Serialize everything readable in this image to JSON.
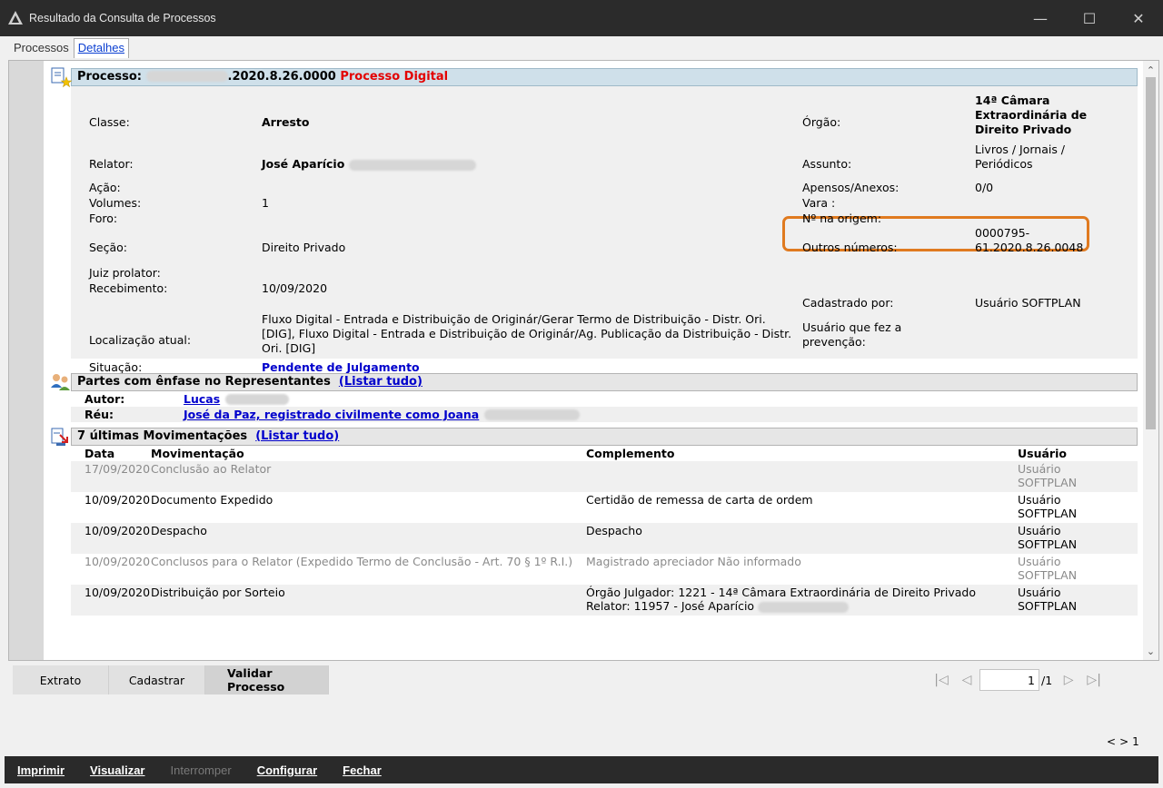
{
  "window": {
    "title": "Resultado da Consulta de Processos"
  },
  "tabs": [
    {
      "label": "Processos"
    },
    {
      "label": "Detalhes"
    }
  ],
  "processo": {
    "header_prefix": "Processo:",
    "numero_visible": ".2020.8.26.0000",
    "tag": "Processo Digital",
    "fields": {
      "classe_label": "Classe:",
      "classe": "Arresto",
      "relator_label": "Relator:",
      "relator": "José Aparício",
      "acao_label": "Ação:",
      "volumes_label": "Volumes:",
      "volumes": "1",
      "foro_label": "Foro:",
      "secao_label": "Seção:",
      "secao": "Direito Privado",
      "juiz_label": "Juiz prolator:",
      "recebimento_label": "Recebimento:",
      "recebimento": "10/09/2020",
      "localizacao_label": "Localização atual:",
      "localizacao": "Fluxo Digital - Entrada e Distribuição de Originár/Gerar Termo de Distribuição - Distr. Ori. [DIG], Fluxo Digital - Entrada e Distribuição de Originár/Ag. Publicação da Distribuição - Distr. Ori. [DIG]",
      "situacao_label": "Situação:",
      "situacao": "Pendente de Julgamento",
      "orgao_label": "Órgão:",
      "orgao": "14ª Câmara Extraordinária de Direito Privado",
      "assunto_label": "Assunto:",
      "assunto": "Livros / Jornais / Periódicos",
      "apensos_label": "Apensos/Anexos:",
      "apensos": "0/0",
      "vara_label": "Vara :",
      "origem_label": "Nº na origem:",
      "outros_label": "Outros números:",
      "outros": "0000795-61.2020.8.26.0048",
      "cadastrado_label": "Cadastrado por:",
      "cadastrado": "Usuário SOFTPLAN",
      "prevencao_label": "Usuário que fez a prevenção:"
    }
  },
  "partes": {
    "title": "Partes com ênfase no Representantes",
    "listar": "(Listar tudo)",
    "rows": [
      {
        "label": "Autor:",
        "value": "Lucas"
      },
      {
        "label": "Réu:",
        "value": "José da Paz, registrado civilmente como Joana"
      }
    ]
  },
  "movimentacoes": {
    "title": "7 últimas Movimentações",
    "listar": "(Listar tudo)",
    "headers": {
      "data": "Data",
      "mov": "Movimentação",
      "comp": "Complemento",
      "user": "Usuário"
    },
    "rows": [
      {
        "data": "17/09/2020",
        "mov": "Conclusão ao Relator",
        "comp": "",
        "user": "Usuário SOFTPLAN"
      },
      {
        "data": "10/09/2020",
        "mov": "Documento Expedido",
        "comp": "Certidão de remessa de carta de ordem",
        "user": "Usuário SOFTPLAN"
      },
      {
        "data": "10/09/2020",
        "mov": "Despacho",
        "comp": "Despacho",
        "user": "Usuário SOFTPLAN"
      },
      {
        "data": "10/09/2020",
        "mov": "Conclusos para o Relator (Expedido Termo de Conclusão - Art. 70 § 1º R.I.)",
        "comp": "Magistrado apreciador Não informado",
        "user": "Usuário SOFTPLAN"
      },
      {
        "data": "10/09/2020",
        "mov": "Distribuição por Sorteio",
        "comp": "Órgão Julgador: 1221 - 14ª Câmara Extraordinária de Direito Privado",
        "comp2": "Relator: 11957 - José Aparício",
        "user": "Usuário SOFTPLAN"
      }
    ]
  },
  "buttons": {
    "extrato": "Extrato",
    "cadastrar": "Cadastrar",
    "validar": "Validar Processo"
  },
  "pager": {
    "page": "1",
    "total": "/1"
  },
  "mini_nav": {
    "prev": "<",
    "next": ">",
    "num": "1"
  },
  "bottom": {
    "imprimir": "Imprimir",
    "visualizar": "Visualizar",
    "interromper": "Interromper",
    "configurar": "Configurar",
    "fechar": "Fechar"
  },
  "colors": {
    "accent_orange": "#e07a1f",
    "link_blue": "#0000cc",
    "digital_red": "#e30000"
  }
}
